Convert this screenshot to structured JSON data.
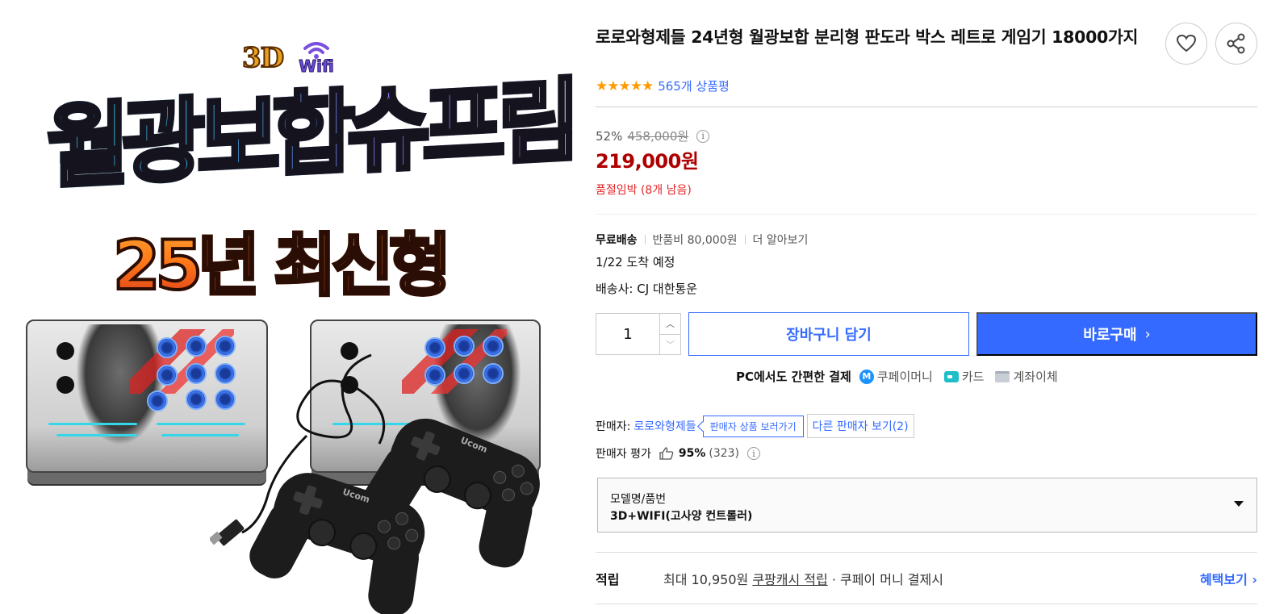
{
  "image": {
    "badge_3d": "3D",
    "badge_wifi": "Wifi",
    "title": "월광보합슈프림",
    "subtitle": "25년 최신형",
    "pad_brand": "Ucom"
  },
  "product": {
    "title": "로로와형제들 24년형 월광보합 분리형 판도라 박스 레트로 게임기 18000가지",
    "stars": "★★★★★",
    "review_count": "565개 상품평",
    "discount_rate": "52%",
    "original_price": "458,000원",
    "sale_price": "219,000원",
    "stock_notice": "품절임박 (8개 남음)"
  },
  "shipping": {
    "free_label": "무료배송",
    "return_fee": "반품비 80,000원",
    "more": "더 알아보기",
    "arrival": "1/22 도착 예정",
    "carrier": "배송사: CJ 대한통운"
  },
  "purchase": {
    "quantity": "1",
    "qty_up": "︿",
    "qty_down": "﹀",
    "cart_label": "장바구니 담기",
    "buy_label": "바로구매",
    "buy_chevron": "›"
  },
  "payment": {
    "title": "PC에서도 간편한 결제",
    "coupay_glyph": "M",
    "coupay": "쿠페이머니",
    "card": "카드",
    "bank": "계좌이체"
  },
  "seller": {
    "label": "판매자:",
    "name": "로로와형제들",
    "products_tag": "판매자 상품 보러가기",
    "other_sellers": "다른 판매자 보기(2)",
    "rating_label": "판매자 평가",
    "rating_pct": "95%",
    "rating_count": "(323)"
  },
  "option": {
    "label": "모델명/품번",
    "value": "3D+WIFI(고사양 컨트롤러)"
  },
  "cashback": {
    "title": "적립",
    "prefix": "최대 10,950원 ",
    "link": "쿠팡캐시 적립",
    "suffix": " · 쿠페이 머니 결제시",
    "benefit": "혜택보기 ›"
  },
  "colors": {
    "accent": "#346aff",
    "price": "#ae0000",
    "stock": "#e52528",
    "star": "#ff9a00"
  },
  "icons": [
    "heart-icon",
    "share-icon",
    "info-icon",
    "thumb-up-icon",
    "coupay-icon",
    "card-icon",
    "bank-icon",
    "caret-down-icon",
    "wifi-icon"
  ]
}
